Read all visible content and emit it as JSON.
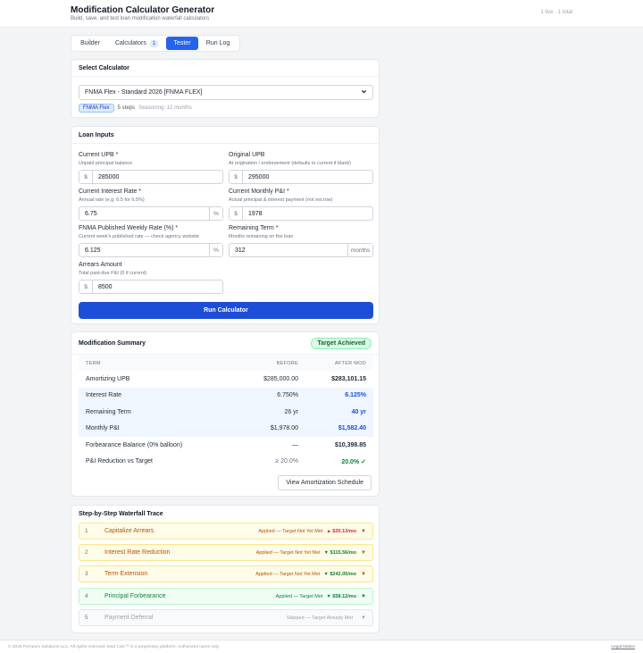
{
  "header": {
    "title": "Modification Calculator Generator",
    "subtitle": "Build, save, and test loan modification waterfall calculators",
    "status": "1 live · 1 total"
  },
  "tabs": [
    {
      "label": "Builder"
    },
    {
      "label": "Calculators",
      "count": "1"
    },
    {
      "label": "Tester"
    },
    {
      "label": "Run Log"
    }
  ],
  "select_calc": {
    "title": "Select Calculator",
    "selected": "FNMA Flex - Standard 2026 [FNMA FLEX]",
    "tag": "FNMA Flex",
    "steps": "5 steps",
    "seasoning": "Seasoning: 12 months"
  },
  "loan_inputs": {
    "title": "Loan Inputs",
    "current_upb": {
      "label": "Current UPB *",
      "help": "Unpaid principal balance",
      "prefix": "$",
      "value": "285000"
    },
    "original_upb": {
      "label": "Original UPB",
      "help": "At origination / endorsement (defaults to current if blank)",
      "prefix": "$",
      "value": "295000"
    },
    "interest_rate": {
      "label": "Current Interest Rate *",
      "help": "Annual rate (e.g. 6.5 for 6.5%)",
      "suffix": "%",
      "value": "6.75"
    },
    "monthly_pi": {
      "label": "Current Monthly P&I *",
      "help": "Actual principal & interest payment (not escrow)",
      "prefix": "$",
      "value": "1978"
    },
    "weekly_rate": {
      "label": "FNMA Published Weekly Rate (%) *",
      "help": "Current week's published rate — check agency website",
      "suffix": "%",
      "value": "6.125"
    },
    "remaining_term": {
      "label": "Remaining Term *",
      "help": "Months remaining on the loan",
      "suffix": "months",
      "value": "312"
    },
    "arrears": {
      "label": "Arrears Amount",
      "help": "Total past-due P&I (0 if current)",
      "prefix": "$",
      "value": "8500"
    },
    "run_button": "Run Calculator"
  },
  "summary": {
    "title": "Modification Summary",
    "status": "Target Achieved",
    "headers": {
      "term": "TERM",
      "before": "BEFORE",
      "after": "AFTER MOD"
    },
    "rows": [
      {
        "term": "Amortizing UPB",
        "before": "$285,000.00",
        "after": "$283,101.15",
        "style": "plain"
      },
      {
        "term": "Interest Rate",
        "before": "6.750%",
        "after": "6.125%",
        "style": "hl"
      },
      {
        "term": "Remaining Term",
        "before": "26 yr",
        "after": "40 yr",
        "style": "hl"
      },
      {
        "term": "Monthly P&I",
        "before": "$1,978.00",
        "after": "$1,582.40",
        "style": "hl"
      },
      {
        "term": "Forbearance Balance (0% balloon)",
        "before": "—",
        "after": "$10,398.85",
        "style": "plain"
      },
      {
        "term": "P&I Reduction vs Target",
        "before": "≥ 20.0%",
        "after": "20.0% ✓",
        "style": "target"
      }
    ],
    "amort_button": "View Amortization Schedule"
  },
  "waterfall": {
    "title": "Step-by-Step Waterfall Trace",
    "steps": [
      {
        "num": "1",
        "name": "Capitalize Arrears",
        "status": "Applied — Target Not Yet Met",
        "delta": "▲ $20.13/mo",
        "kind": "yellow",
        "dir": "up"
      },
      {
        "num": "2",
        "name": "Interest Rate Reduction",
        "status": "Applied — Target Not Yet Met",
        "delta": "▼ $115.56/mo",
        "kind": "yellow",
        "dir": "down"
      },
      {
        "num": "3",
        "name": "Term Extension",
        "status": "Applied — Target Not Yet Met",
        "delta": "▼ $242.05/mo",
        "kind": "yellow",
        "dir": "down"
      },
      {
        "num": "4",
        "name": "Principal Forbearance",
        "status": "Applied — Target Met",
        "delta": "▼ $58.12/mo",
        "kind": "green",
        "dir": "down"
      },
      {
        "num": "5",
        "name": "Payment Deferral",
        "status": "Skipped — Target Already Met",
        "delta": "",
        "kind": "gray",
        "dir": ""
      }
    ]
  },
  "footer": {
    "copyright": "© 2026 Pyrheum Solutions LLC. All rights reserved. Mod Calc™ is a proprietary platform. Authorized users only.",
    "link": "Legal Notice"
  }
}
